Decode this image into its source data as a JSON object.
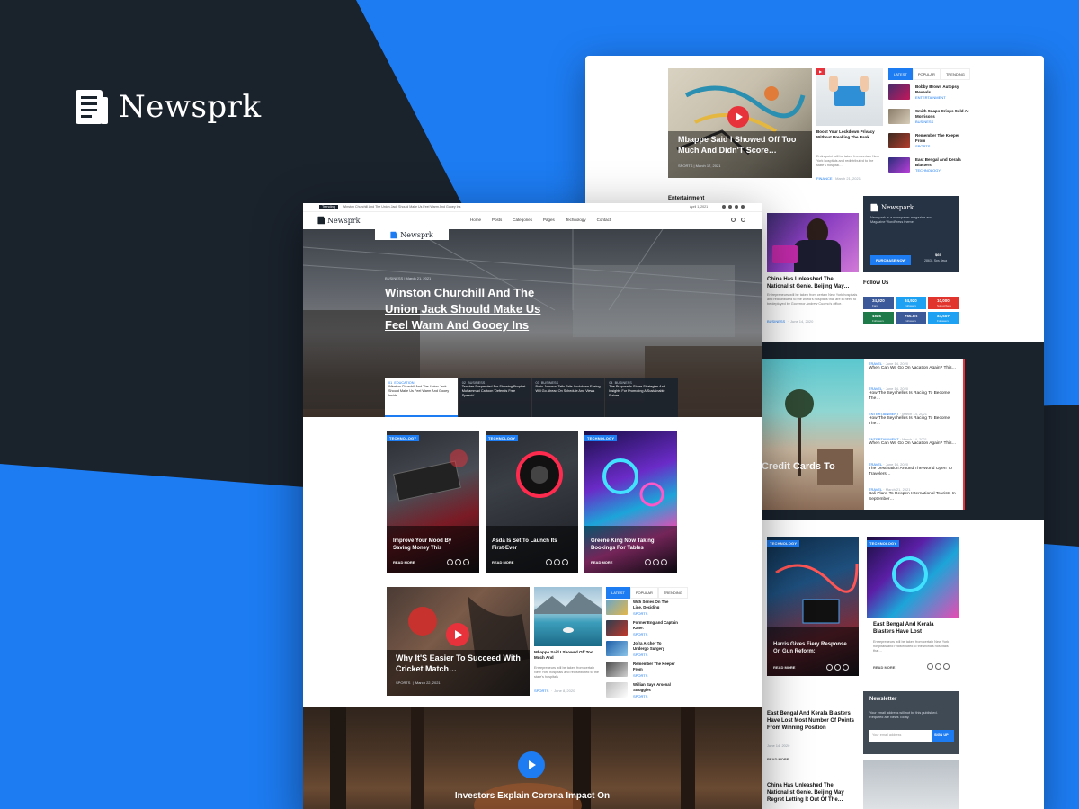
{
  "brand": {
    "name": "Newsprk"
  },
  "colors": {
    "accent": "#1d7cf2",
    "dark": "#1a222c",
    "red": "#e8323b"
  },
  "back": {
    "video_title": "Mbappe Said I Showed Off Too Much And Didn'T Score…",
    "video_meta_cat": "SPORTS",
    "video_meta_date": "March 17, 2021",
    "side_title": "Boost Your Lockdown Privacy Without Breaking The Bank",
    "side_excerpt": "Entirepoint will be taken from certain New York hospitals and redistributed to the state's hospital…",
    "side_meta_cat": "FINANCE",
    "side_meta_date": "March 21, 2021",
    "tabs": [
      "LATEST",
      "POPULAR",
      "TRENDING"
    ],
    "latest": [
      {
        "title": "Bobby Brown Autopsy Reveals",
        "cat": "ENTERTAINMENT"
      },
      {
        "title": "Smith Snaps Crisps Sold At Morrisons",
        "cat": "BUSINESS"
      },
      {
        "title": "Remember The Keeper From",
        "cat": "SPORTS"
      },
      {
        "title": "East Bengal And Kerala Blasters",
        "cat": "TECHNOLOGY"
      }
    ],
    "section_entertainment": "Entertainment",
    "ent_title": "China Has Unleashed The Nationalist Genie. Beijing May…",
    "ent_excerpt": "Entrepreneurs will be taken from certain New York hospitals and redistributed to the world's hospitals that are in need to be deployed by Governor Andrew Cuomo's office.",
    "ent_meta_cat": "BUSINESS",
    "ent_meta_date": "June 14, 2020",
    "ad_brand": "Newspark",
    "ad_text": "Newspark Is a newspaper magazine and Magazine WordPress theme",
    "ad_button": "PURCHASE NOW",
    "ad_price": "$69",
    "ad_price_note": "28631 Sps Java",
    "follow_us": "Follow Us",
    "follow": [
      {
        "count": "34,920",
        "label": "Fans",
        "color": "#3b5998"
      },
      {
        "count": "34,920",
        "label": "Followers",
        "color": "#1da1f2"
      },
      {
        "count": "10,000",
        "label": "Subscribers",
        "color": "#e0342c"
      },
      {
        "count": "1025",
        "label": "Followers",
        "color": "#1f7a4a"
      },
      {
        "count": "765.6K",
        "label": "Followers",
        "color": "#3b5998"
      },
      {
        "count": "34,567",
        "label": "Followers",
        "color": "#1da1f2"
      }
    ],
    "dark_overlay_title": "Credit Cards To",
    "dark_list": [
      {
        "cat": "TRAVEL",
        "date": "June 14, 2020",
        "title": "When Can We Go On Vacation Again? This…"
      },
      {
        "cat": "TRAVEL",
        "date": "June 14, 2020",
        "title": "How The Seychelles Is Racing To Become The…"
      },
      {
        "cat": "ENTERTAINMENT",
        "date": "March 14, 2021",
        "title": "How The Seychelles Is Racing To Become The…"
      },
      {
        "cat": "ENTERTAINMENT",
        "date": "March 14, 2021",
        "title": "When Can We Go On Vacation Again? This…"
      },
      {
        "cat": "TRAVEL",
        "date": "June 14, 2020",
        "title": "The Destination Around The World Open To Travelers…"
      },
      {
        "cat": "TRAVEL",
        "date": "March 21, 2021",
        "title": "Bali Plans To Reopen International Tourists In September…"
      }
    ],
    "tech_cards": [
      {
        "tag": "TECHNOLOGY",
        "title": "Harris Gives Fiery Response On Gun Reform:",
        "readmore": "READ MORE"
      },
      {
        "tag": "TECHNOLOGY",
        "title": "East Bengal And Kerala Blasters Have Lost",
        "excerpt": "Entrepreneurs will be taken from certain New York hospitals and redistributed to the world's hospitals that…",
        "readmore": "READ MORE"
      }
    ],
    "list_title_1": "East Bengal And Kerala Blasters Have Lost Most Number Of Points From Winning Position",
    "list_meta_1": "June 14, 2020",
    "list_read_1": "READ MORE",
    "list_title_2": "China Has Unleashed The Nationalist Genie. Beijing May Regret Letting It Out Of The…",
    "newsletter_title": "Newsletter",
    "newsletter_text": "Your email address will not be this published. Required are News Today.",
    "newsletter_placeholder": "Your email address",
    "newsletter_button": "SIGN UP"
  },
  "front": {
    "topbar_label": "Trending",
    "topbar_text": "Winston Churchill And The Union Jack Should Make Us Feel Warm And Gooey Ins",
    "topbar_date": "April 1, 2021",
    "nav": [
      "Home",
      "Posts",
      "Categories",
      "Pages",
      "Technology",
      "Contact"
    ],
    "logo_overlay": "Newsprk",
    "hero_meta": "BUSINESS  |  March 21, 2021",
    "hero_title": "Winston Churchill And The Union Jack Should Make Us Feel Warm And Gooey Ins",
    "hero_tiles": [
      {
        "num": "01",
        "cat": "EDUCATION",
        "title": "Winston Churchill And The Union Jack Should Make Us Feel Warm And Gooey Inside"
      },
      {
        "num": "02",
        "cat": "BUSINESS",
        "title": "Teacher Suspended For Showing Prophet Muhammad Cartoon 'Defends Free Speech'"
      },
      {
        "num": "03",
        "cat": "BUSINESS",
        "title": "Boris Johnson Tells Brits Lockdown Easing Will Go Ahead On Schedule And Views"
      },
      {
        "num": "04",
        "cat": "BUSINESS",
        "title": "The Purpose Is Share Strategies And Insights For Promoting A Sustainable Future"
      }
    ],
    "tech_cards": [
      {
        "tag": "TECHNOLOGY",
        "title": "Improve Your Mood By Saving Money This",
        "readmore": "READ MORE"
      },
      {
        "tag": "TECHNOLOGY",
        "title": "Asda Is Set To Launch Its First-Ever",
        "readmore": "READ MORE"
      },
      {
        "tag": "TECHNOLOGY",
        "title": "Greene King Now Taking Bookings For Tables",
        "readmore": "READ MORE"
      }
    ],
    "video_title": "Why It'S Easier To Succeed With Cricket Match…",
    "video_meta_cat": "SPORTS",
    "video_meta_date": "March 22, 2021",
    "mid_title": "Mbappe Said I Showed Off Too Much And",
    "mid_excerpt": "Entrepreneurs will be taken from certain New York hospitals and redistributed to the state's hospitals",
    "mid_meta_cat": "SPORTS",
    "mid_meta_date": "June 8, 2020",
    "tabs": [
      "LATEST",
      "POPULAR",
      "TRENDING"
    ],
    "latest": [
      {
        "title": "With Series On The Line, Deciding",
        "cat": "SPORTS"
      },
      {
        "title": "Former England Captain Kane:",
        "cat": "SPORTS"
      },
      {
        "title": "Jofra Archer To Undergo Surgery",
        "cat": "SPORTS"
      },
      {
        "title": "Remember The Keeper From",
        "cat": "SPORTS"
      },
      {
        "title": "Willian Says Arsenal Struggles",
        "cat": "SPORTS"
      }
    ],
    "bottom_title": "Investors Explain Corona Impact On"
  }
}
